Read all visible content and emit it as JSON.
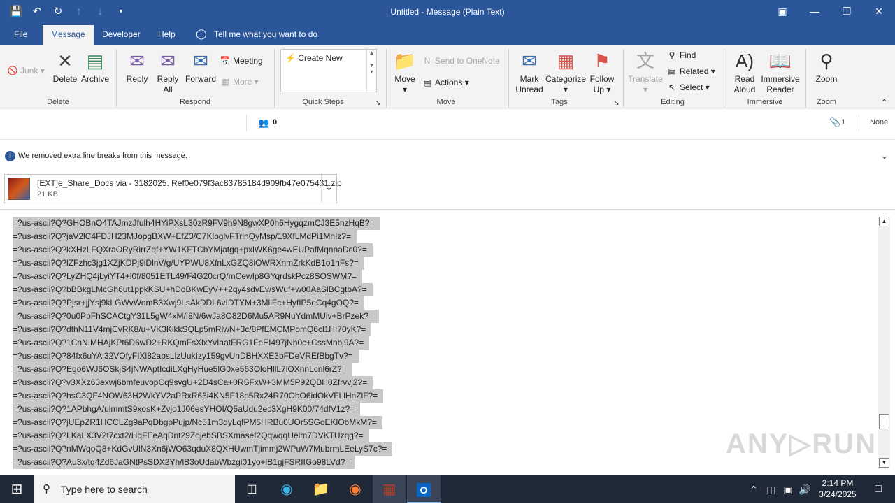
{
  "window": {
    "title": "Untitled  -  Message (Plain Text)"
  },
  "menu": {
    "file": "File",
    "message": "Message",
    "developer": "Developer",
    "help": "Help",
    "tell_me": "Tell me what you want to do"
  },
  "ribbon": {
    "junk": "Junk",
    "delete": "Delete",
    "archive": "Archive",
    "reply": "Reply",
    "reply_all_1": "Reply",
    "reply_all_2": "All",
    "forward": "Forward",
    "meeting": "Meeting",
    "more": "More",
    "quick_steps_item": "Create New",
    "move": "Move",
    "send_onenote": "Send to OneNote",
    "actions": "Actions",
    "mark_unread_1": "Mark",
    "mark_unread_2": "Unread",
    "categorize": "Categorize",
    "follow_up_1": "Follow",
    "follow_up_2": "Up",
    "translate": "Translate",
    "find": "Find",
    "related": "Related",
    "select": "Select",
    "read_aloud_1": "Read",
    "read_aloud_2": "Aloud",
    "immersive_1": "Immersive",
    "immersive_2": "Reader",
    "zoom": "Zoom",
    "groups": {
      "delete": "Delete",
      "respond": "Respond",
      "quick_steps": "Quick Steps",
      "move": "Move",
      "tags": "Tags",
      "editing": "Editing",
      "immersive": "Immersive",
      "zoom": "Zoom"
    }
  },
  "info": {
    "people_count": "0",
    "attachment_count": "1",
    "sensitivity": "None"
  },
  "notice": "We removed extra line breaks from this message.",
  "attachment": {
    "name": "[EXT]e_Share_Docs via - 3182025.  Ref0e079f3ac83785184d909fb47e075431.zip",
    "size": "21 KB"
  },
  "body_lines": [
    "=?us-ascii?Q?GHOBnO4TAJmzJfulh4HYiPXsL30zR9FV9h9N8gwXP0h6HygqzmCJ3E5nzHqB?=",
    "=?us-ascii?Q?jaV2lC4FDJH23MJopgBXW+EfZ3/C7KlbglvFTrinQyMsp/19XfLMdPi1MnIz?=",
    "=?us-ascii?Q?kXHzLFQXraORyRirrZqf+YW1KFTCbYMjatgq+pxlWK6ge4wEUPafMqnnaDc0?=",
    "=?us-ascii?Q?lZFzhc3jg1XZjKDPj9iDlnV/g/UYPWU8XfnLxGZQ8lOWRXnmZrkKdB1o1hFs?=",
    "=?us-ascii?Q?LyZHQ4jLyiYT4+l0f/8051ETL49/F4G20crQ/mCewIp8GYqrdskPcz8SOSWM?=",
    "=?us-ascii?Q?bBBkgLMcGh6ut1ppkKSU+hDoBKwEyV++2qy4sdvEv/sWuf+w00AaSlBCgtbA?=",
    "=?us-ascii?Q?Pjsr+jjYsj9kLGWvWomB3Xwj9LsAkDDL6vIDTYM+3MllFc+HyfIP5eCq4gOQ?=",
    "=?us-ascii?Q?0u0PpFhSCACtgY31L5gW4xM/I8N/6wJa8O82D6Mu5AR9NuYdmMUiv+BrPzek?=",
    "=?us-ascii?Q?dthN11V4mjCvRK8/u+VK3KikkSQLp5mRlwN+3c/8PfEMCMPomQ6cl1HI70yK?=",
    "=?us-ascii?Q?1CnNIMHAjKPt6D6wD2+RKQmFsXlxYvIaatFRG1FeEI497jNh0c+CssMnbj9A?=",
    "=?us-ascii?Q?84fx6uYAl32VOfyFIXl82apsLlzUukIzy159gvUnDBHXXE3bFDeVREfBbgTv?=",
    "=?us-ascii?Q?Ego6WJ6OSkjS4jNWAptIcdiLXgHyHue5lG0xe563OloHllL7iOXnnLcnl6rZ?=",
    "=?us-ascii?Q?v3XXz63exwj6bmfeuvopCq9svgU+2D4sCa+0RSFxW+3MM5P92QBH0Zfrvvj2?=",
    "=?us-ascii?Q?hsC3QF4NOW63H2WkYV2aPRxR63i4KN5F18p5Rx24R70ObO6idOkVFLlHnZlF?=",
    "=?us-ascii?Q?1APbhgA/ulmmtS9xosK+Zvjo1J06esYHOI/Q5aUdu2ec3XgH9K00/74dfV1z?=",
    "=?us-ascii?Q?jUEpZR1HCCLZg9aPqDbgpPujp/Nc51m3dyLqfPM5HRBu0UOr5SGoEKlObMkM?=",
    "=?us-ascii?Q?LKaLX3V2t7cxt2/HqFEeAqDnt29ZojebSBSXmasef2QqwqqUelm7DVKTUzqg?=",
    "=?us-ascii?Q?nMWqoQ8+KdGvUlN3Xn6jWO63qduX8QXHUwmTjimmj2WPuW7MubrmLEeLyS7c?=",
    "=?us-ascii?Q?Au3x/tq4Zd6JaGNtPsSDX2Yh/lB3oUdabWbzgi01yo+lB1gjFSRIIGo98LVd?="
  ],
  "taskbar": {
    "search_placeholder": "Type here to search",
    "time": "2:14 PM",
    "date": "3/24/2025"
  },
  "colors": {
    "accent": "#2b579a",
    "selection": "#c8c8c8"
  }
}
